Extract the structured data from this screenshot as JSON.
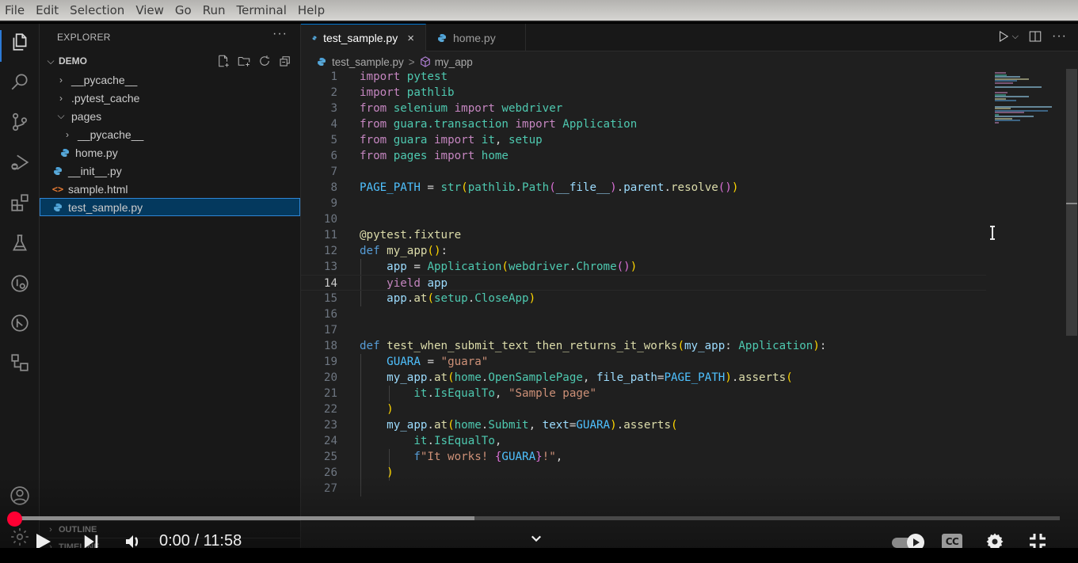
{
  "menubar": {
    "items": [
      "File",
      "Edit",
      "Selection",
      "View",
      "Go",
      "Run",
      "Terminal",
      "Help"
    ]
  },
  "activity_bar": {
    "items": [
      "explorer-icon",
      "search-icon",
      "source-control-icon",
      "run-debug-icon",
      "extensions-icon",
      "testing-icon",
      "remote-explorer-icon",
      "git-graph-icon",
      "diagram-icon"
    ],
    "bottom": [
      "account-icon",
      "manage-gear-icon"
    ]
  },
  "sidebar": {
    "title": "EXPLORER",
    "more": "···",
    "section": "DEMO",
    "tree": [
      {
        "label": "__pycache__",
        "type": "folder",
        "expanded": false,
        "depth": 1
      },
      {
        "label": ".pytest_cache",
        "type": "folder",
        "expanded": false,
        "depth": 1
      },
      {
        "label": "pages",
        "type": "folder",
        "expanded": true,
        "depth": 1
      },
      {
        "label": "__pycache__",
        "type": "folder",
        "expanded": false,
        "depth": 2
      },
      {
        "label": "home.py",
        "type": "python",
        "depth": 2
      },
      {
        "label": "__init__.py",
        "type": "python",
        "depth": 1
      },
      {
        "label": "sample.html",
        "type": "html",
        "depth": 1
      },
      {
        "label": "test_sample.py",
        "type": "python",
        "depth": 1,
        "selected": true
      }
    ],
    "outline_label": "OUTLINE",
    "timeline_label": "TIMELINE"
  },
  "editor": {
    "tabs": [
      {
        "label": "test_sample.py",
        "active": true,
        "close": "×"
      },
      {
        "label": "home.py",
        "active": false
      }
    ],
    "breadcrumb": {
      "file": "test_sample.py",
      "sep": ">",
      "symbol": "my_app"
    },
    "current_line": 14,
    "lines": [
      {
        "n": 1,
        "html": "<span class='kw'>import</span> <span class='mod'>pytest</span>"
      },
      {
        "n": 2,
        "html": "<span class='kw'>import</span> <span class='mod'>pathlib</span>"
      },
      {
        "n": 3,
        "html": "<span class='kw'>from</span> <span class='mod'>selenium</span> <span class='kw'>import</span> <span class='mod'>webdriver</span>"
      },
      {
        "n": 4,
        "html": "<span class='kw'>from</span> <span class='mod'>guara.transaction</span> <span class='kw'>import</span> <span class='mod'>Application</span>"
      },
      {
        "n": 5,
        "html": "<span class='kw'>from</span> <span class='mod'>guara</span> <span class='kw'>import</span> <span class='mod'>it</span><span class='op'>, </span><span class='mod'>setup</span>"
      },
      {
        "n": 6,
        "html": "<span class='kw'>from</span> <span class='mod'>pages</span> <span class='kw'>import</span> <span class='mod'>home</span>"
      },
      {
        "n": 7,
        "html": ""
      },
      {
        "n": 8,
        "html": "<span class='cst'>PAGE_PATH</span> <span class='op'>=</span> <span class='mod'>str</span><span class='br1'>(</span><span class='mod'>pathlib</span><span class='op'>.</span><span class='mod'>Path</span><span class='br2'>(</span><span class='var'>__file__</span><span class='br2'>)</span><span class='op'>.</span><span class='var'>parent</span><span class='op'>.</span><span class='fn'>resolve</span><span class='br2'>()</span><span class='br1'>)</span>"
      },
      {
        "n": 9,
        "html": ""
      },
      {
        "n": 10,
        "html": ""
      },
      {
        "n": 11,
        "html": "<span class='fn'>@pytest.fixture</span>"
      },
      {
        "n": 12,
        "html": "<span class='kwd'>def</span> <span class='fn'>my_app</span><span class='br1'>()</span><span class='op'>:</span>"
      },
      {
        "n": 13,
        "html": "    <span class='var'>app</span> <span class='op'>=</span> <span class='mod'>Application</span><span class='br1'>(</span><span class='mod'>webdriver</span><span class='op'>.</span><span class='mod'>Chrome</span><span class='br2'>()</span><span class='br1'>)</span>"
      },
      {
        "n": 14,
        "html": "    <span class='kw'>yield</span> <span class='var'>app</span>"
      },
      {
        "n": 15,
        "html": "    <span class='var'>app</span><span class='op'>.</span><span class='fn'>at</span><span class='br1'>(</span><span class='mod'>setup</span><span class='op'>.</span><span class='mod'>CloseApp</span><span class='br1'>)</span>"
      },
      {
        "n": 16,
        "html": ""
      },
      {
        "n": 17,
        "html": ""
      },
      {
        "n": 18,
        "html": "<span class='kwd'>def</span> <span class='fn'>test_when_submit_text_then_returns_it_works</span><span class='br1'>(</span><span class='var'>my_app</span><span class='op'>: </span><span class='mod'>Application</span><span class='br1'>)</span><span class='op'>:</span>"
      },
      {
        "n": 19,
        "html": "    <span class='cst'>GUARA</span> <span class='op'>=</span> <span class='str'>\"guara\"</span>"
      },
      {
        "n": 20,
        "html": "    <span class='var'>my_app</span><span class='op'>.</span><span class='fn'>at</span><span class='br1'>(</span><span class='mod'>home</span><span class='op'>.</span><span class='mod'>OpenSamplePage</span><span class='op'>, </span><span class='var'>file_path</span><span class='op'>=</span><span class='cst'>PAGE_PATH</span><span class='br1'>)</span><span class='op'>.</span><span class='fn'>asserts</span><span class='br1'>(</span>"
      },
      {
        "n": 21,
        "html": "        <span class='mod'>it</span><span class='op'>.</span><span class='mod'>IsEqualTo</span><span class='op'>, </span><span class='str'>\"Sample page\"</span>"
      },
      {
        "n": 22,
        "html": "    <span class='br1'>)</span>"
      },
      {
        "n": 23,
        "html": "    <span class='var'>my_app</span><span class='op'>.</span><span class='fn'>at</span><span class='br1'>(</span><span class='mod'>home</span><span class='op'>.</span><span class='mod'>Submit</span><span class='op'>, </span><span class='var'>text</span><span class='op'>=</span><span class='cst'>GUARA</span><span class='br1'>)</span><span class='op'>.</span><span class='fn'>asserts</span><span class='br1'>(</span>"
      },
      {
        "n": 24,
        "html": "        <span class='mod'>it</span><span class='op'>.</span><span class='mod'>IsEqualTo</span><span class='op'>,</span>"
      },
      {
        "n": 25,
        "html": "        <span class='kwd'>f</span><span class='str'>\"It works! </span><span class='br2'>{</span><span class='cst'>GUARA</span><span class='br2'>}</span><span class='str'>!\"</span><span class='op'>,</span>"
      },
      {
        "n": 26,
        "html": "    <span class='br1'>)</span>"
      },
      {
        "n": 27,
        "html": ""
      }
    ]
  },
  "video_player": {
    "current_time": "0:00",
    "duration": "11:58",
    "time_display": "0:00 / 11:58",
    "played_fraction": 0.0,
    "buffered_fraction": 0.44,
    "cc_label": "CC",
    "colors": {
      "progress": "#ff0033"
    }
  }
}
